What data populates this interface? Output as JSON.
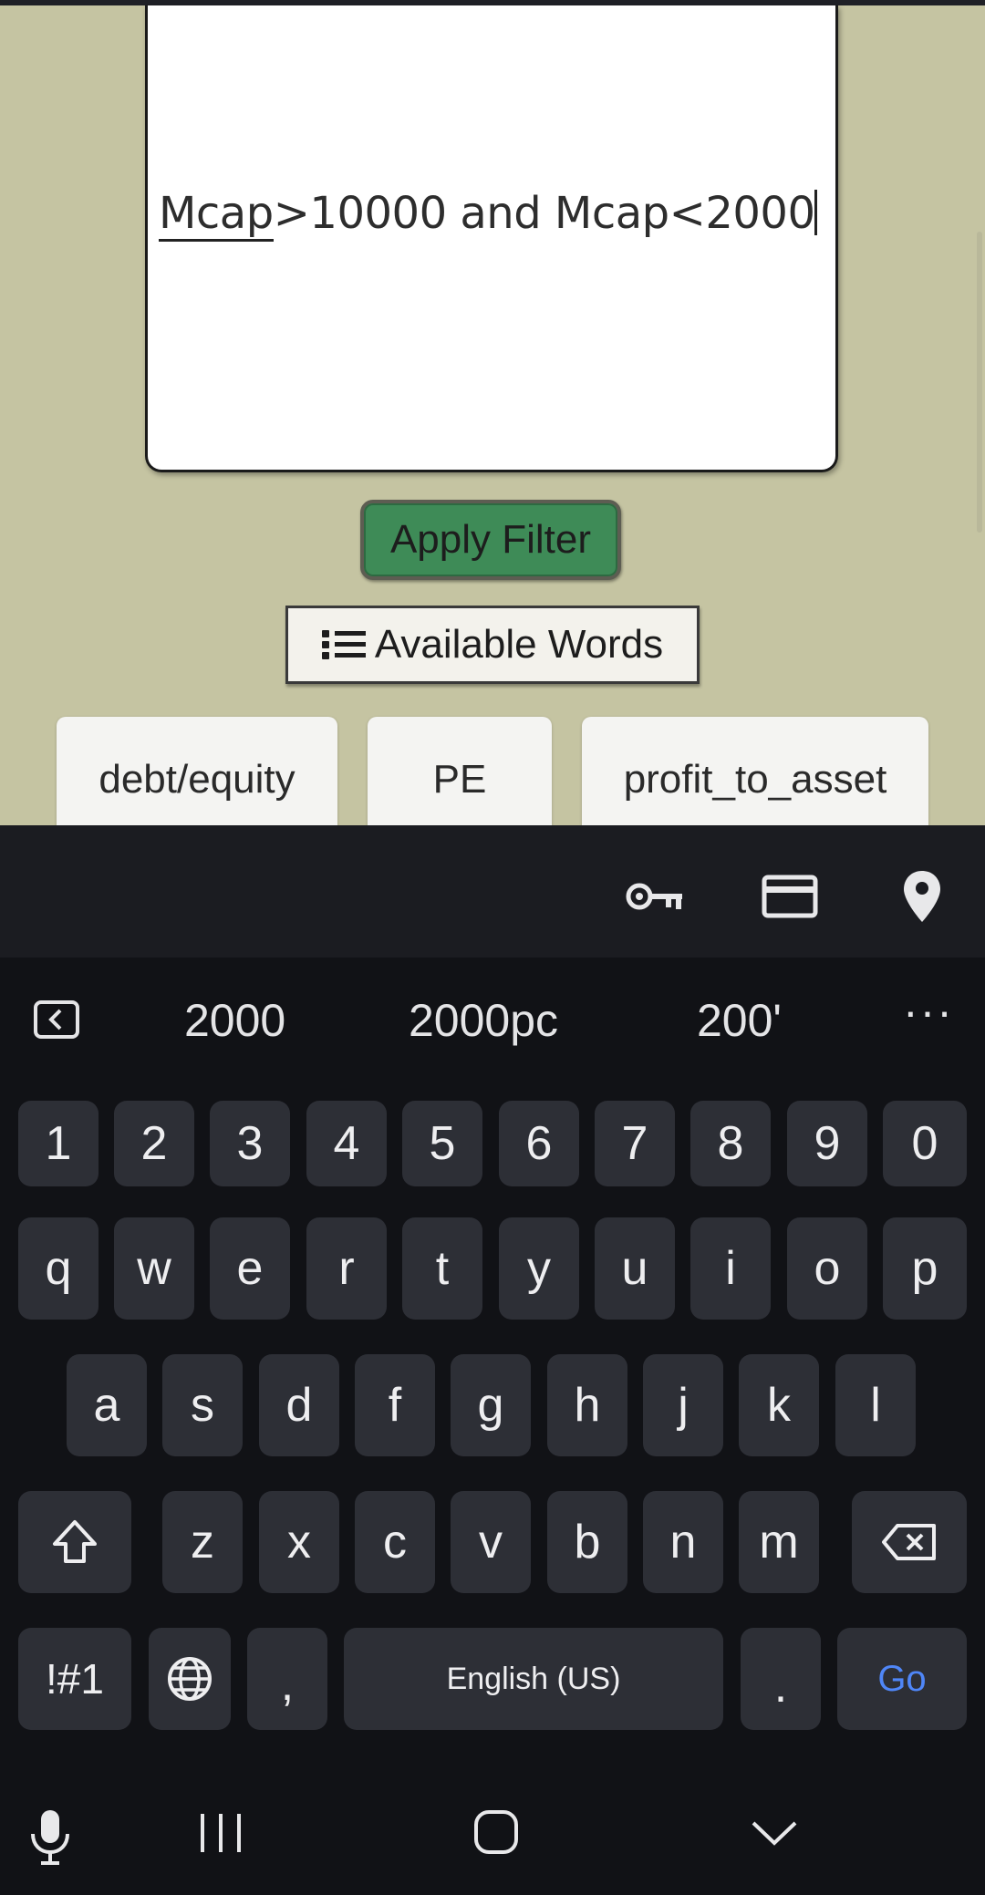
{
  "editor": {
    "word1": "Mcap",
    "rest": ">10000 and Mcap<2000"
  },
  "apply_filter_label": "Apply Filter",
  "available_words_label": "Available Words",
  "chips": [
    "debt/equity",
    "PE",
    "profit_to_asset"
  ],
  "keyboard": {
    "suggestions": [
      "2000",
      "2000pc",
      "200'"
    ],
    "more_label": "···",
    "row_numbers": [
      "1",
      "2",
      "3",
      "4",
      "5",
      "6",
      "7",
      "8",
      "9",
      "0"
    ],
    "row_q": [
      "q",
      "w",
      "e",
      "r",
      "t",
      "y",
      "u",
      "i",
      "o",
      "p"
    ],
    "row_a": [
      "a",
      "s",
      "d",
      "f",
      "g",
      "h",
      "j",
      "k",
      "l"
    ],
    "row_z": [
      "z",
      "x",
      "c",
      "v",
      "b",
      "n",
      "m"
    ],
    "symbols_label": "!#1",
    "comma_label": ",",
    "space_label": "English (US)",
    "period_label": ".",
    "go_label": "Go",
    "go_color": "#4f86f7"
  },
  "icons": [
    "key-icon",
    "card-icon",
    "location-pin-icon",
    "collapse-icon",
    "shift-icon",
    "backspace-icon",
    "globe-icon",
    "mic-icon",
    "recents-icon",
    "home-icon",
    "hide-keyboard-icon",
    "list-icon"
  ]
}
